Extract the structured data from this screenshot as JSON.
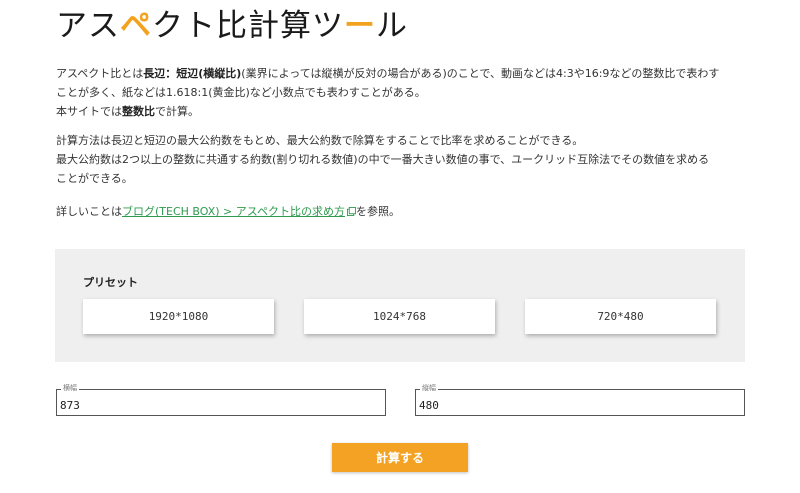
{
  "header": {
    "title_part1": "アス",
    "title_mark": "ペ",
    "title_part2": "クト比計算ツ",
    "title_mark2": "ー",
    "title_part3": "ル"
  },
  "description": {
    "p1_a": "アスペクト比とは",
    "p1_b": "長辺：短辺(横縦比)",
    "p1_c": "(業界によっては縦横が反対の場合がある)のことで、動画などは4:3や16:9などの整数比で表わす",
    "p1_d": "ことが多く、紙などは1.618:1(黄金比)など小数点でも表わすことがある。",
    "p2_a": "本サイトでは",
    "p2_b": "整数比",
    "p2_c": "で計算。",
    "p3": "計算方法は長辺と短辺の最大公約数をもとめ、最大公約数で除算をすることで比率を求めることができる。",
    "p4": "最大公約数は2つ以上の整数に共通する約数(割り切れる数値)の中で一番大きい数値の事で、ユークリッド互除法でその数値を求める",
    "p5": "ことができる。",
    "p6_a": "詳しいことは",
    "p6_link": "ブログ(TECH BOX) > アスペクト比の求め方",
    "p6_b": "を参照。"
  },
  "presets": {
    "title": "プリセット",
    "items": [
      "1920*1080",
      "1024*768",
      "720*480"
    ]
  },
  "width_field": {
    "label": "横幅",
    "value": "873"
  },
  "height_field": {
    "label": "縦幅",
    "value": "480"
  },
  "calc_button": {
    "label": "計算する"
  },
  "colors": {
    "accent": "#f4a223",
    "link": "#2f9a4e",
    "panel": "#efefef"
  }
}
